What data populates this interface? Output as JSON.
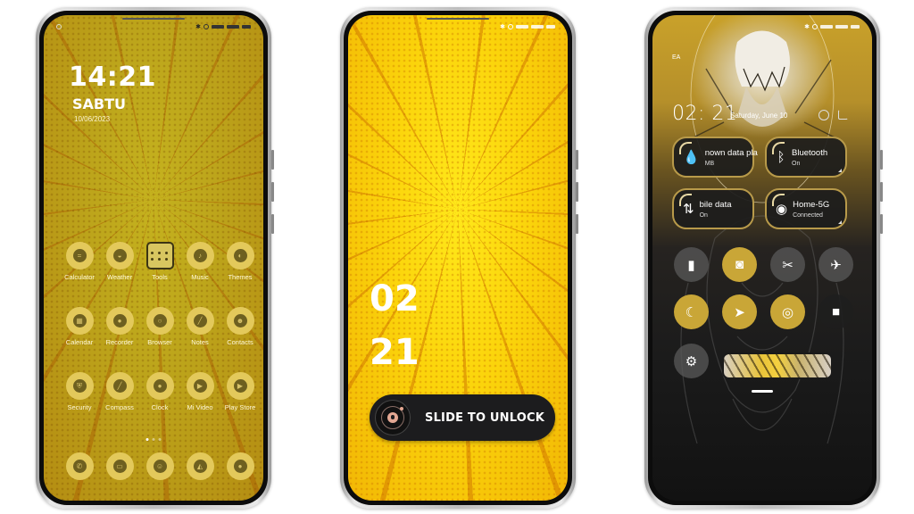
{
  "phones": [
    {
      "name": "home-screen",
      "clock": "14:21",
      "day": "SABTU",
      "date": "10/06/2023",
      "apps": [
        {
          "label": "Calculator",
          "icon": "calculator-icon",
          "glyph": "="
        },
        {
          "label": "Weather",
          "icon": "weather-icon",
          "glyph": "◒"
        },
        {
          "label": "Tools",
          "icon": "tools-icon",
          "glyph": ""
        },
        {
          "label": "Music",
          "icon": "music-icon",
          "glyph": "♪"
        },
        {
          "label": "Themes",
          "icon": "themes-icon",
          "glyph": "◐"
        },
        {
          "label": "Calendar",
          "icon": "calendar-icon",
          "glyph": "▦"
        },
        {
          "label": "Recorder",
          "icon": "recorder-icon",
          "glyph": "●"
        },
        {
          "label": "Browser",
          "icon": "browser-icon",
          "glyph": "○"
        },
        {
          "label": "Notes",
          "icon": "notes-icon",
          "glyph": "╱"
        },
        {
          "label": "Contacts",
          "icon": "contacts-icon",
          "glyph": "☻"
        },
        {
          "label": "Security",
          "icon": "security-icon",
          "glyph": "⛨"
        },
        {
          "label": "Compass",
          "icon": "compass-icon",
          "glyph": "╱"
        },
        {
          "label": "Clock",
          "icon": "clock-icon",
          "glyph": "●"
        },
        {
          "label": "Mi Video",
          "icon": "video-icon",
          "glyph": "▶"
        },
        {
          "label": "Play Store",
          "icon": "play-store-icon",
          "glyph": "▶"
        }
      ],
      "dock": [
        {
          "icon": "phone-icon",
          "glyph": "✆"
        },
        {
          "icon": "messages-icon",
          "glyph": "▭"
        },
        {
          "icon": "camera-app-icon",
          "glyph": "☺"
        },
        {
          "icon": "gallery-icon",
          "glyph": "◭"
        },
        {
          "icon": "camera-icon",
          "glyph": "●"
        }
      ],
      "page_indicator": {
        "pages": 3,
        "current": 1
      }
    },
    {
      "name": "lock-screen",
      "hour": "02",
      "minute": "21",
      "slide_label": "SLIDE TO UNLOCK"
    },
    {
      "name": "control-center",
      "carrier": "EA",
      "clock": "02: 21",
      "date": "Saturday, June 10",
      "tiles": [
        {
          "title": "Unknown data plan",
          "visible_title": "nown data pla",
          "sub": "MB",
          "icon": "data-drop-icon",
          "glyph": "💧"
        },
        {
          "title": "Bluetooth",
          "visible_title": "Bluetooth",
          "sub": "On",
          "icon": "bluetooth-icon",
          "glyph": "ᛒ"
        },
        {
          "title": "Mobile data",
          "visible_title": "bile data",
          "sub": "On",
          "icon": "mobile-data-icon",
          "glyph": "⇅"
        },
        {
          "title": "Home-5G",
          "visible_title": "Home-5G",
          "sub": "Connected",
          "icon": "wifi-icon",
          "glyph": "◉"
        }
      ],
      "toggles": [
        {
          "name": "flashlight",
          "icon": "flashlight-icon",
          "glyph": "▮",
          "state": "off"
        },
        {
          "name": "mute",
          "icon": "bell-mute-icon",
          "glyph": "◙",
          "state": "on"
        },
        {
          "name": "screenshot",
          "icon": "screenshot-icon",
          "glyph": "✂",
          "state": "off"
        },
        {
          "name": "airplane",
          "icon": "airplane-icon",
          "glyph": "✈",
          "state": "off"
        },
        {
          "name": "dark-mode",
          "icon": "moon-icon",
          "glyph": "☾",
          "state": "on"
        },
        {
          "name": "location",
          "icon": "location-icon",
          "glyph": "➤",
          "state": "on"
        },
        {
          "name": "auto-rotate",
          "icon": "rotate-icon",
          "glyph": "◎",
          "state": "on"
        },
        {
          "name": "video",
          "icon": "video-camera-icon",
          "glyph": "■",
          "state": "dark"
        },
        {
          "name": "brightness",
          "icon": "brightness-icon",
          "glyph": "⚙",
          "state": "off"
        }
      ]
    }
  ],
  "colors": {
    "accent_gold": "#c9a637",
    "tile_border": "#b89a4a",
    "home_icon_bg": "#e3c95b",
    "slider_bg": "#1c1c1e",
    "lock_accent": "#e4a893"
  }
}
